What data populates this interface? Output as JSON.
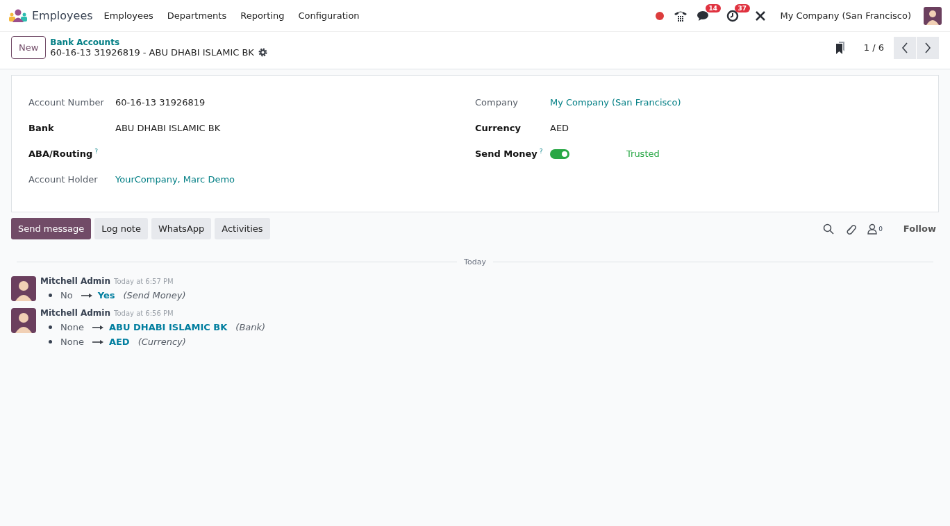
{
  "navbar": {
    "app_name": "Employees",
    "menu": [
      "Employees",
      "Departments",
      "Reporting",
      "Configuration"
    ],
    "messages_count": "14",
    "activities_count": "37",
    "company": "My Company (San Francisco)"
  },
  "control_panel": {
    "new_button": "New",
    "breadcrumb": "Bank Accounts",
    "record_title": "60-16-13 31926819 - ABU DHABI ISLAMIC BK",
    "pager": "1 / 6"
  },
  "form": {
    "left": [
      {
        "label": "Account Number",
        "required": false,
        "kind": "text",
        "value": "60-16-13 31926819"
      },
      {
        "label": "Bank",
        "required": true,
        "kind": "text",
        "value": "ABU DHABI ISLAMIC BK"
      },
      {
        "label": "ABA/Routing",
        "required": true,
        "help": "?",
        "kind": "empty"
      },
      {
        "label": "Account Holder",
        "required": false,
        "kind": "link",
        "value": "YourCompany, Marc Demo"
      }
    ],
    "right": [
      {
        "label": "Company",
        "required": false,
        "kind": "link",
        "value": "My Company (San Francisco)"
      },
      {
        "label": "Currency",
        "required": true,
        "kind": "text",
        "value": "AED"
      },
      {
        "label": "Send Money",
        "required": true,
        "help": "?",
        "kind": "toggle",
        "on": true,
        "value": "Trusted"
      }
    ]
  },
  "chatter": {
    "buttons": [
      {
        "label": "Send message",
        "selected": true
      },
      {
        "label": "Log note",
        "selected": false
      },
      {
        "label": "WhatsApp",
        "selected": false
      },
      {
        "label": "Activities",
        "selected": false
      }
    ],
    "followers_count": "0",
    "follow": "Follow",
    "separator": "Today",
    "messages": [
      {
        "author": "Mitchell Admin",
        "date": "Today at 6:57 PM",
        "changes": [
          {
            "old": "No",
            "new": "Yes",
            "field": "(Send Money)"
          }
        ]
      },
      {
        "author": "Mitchell Admin",
        "date": "Today at 6:56 PM",
        "changes": [
          {
            "old": "None",
            "new": "ABU DHABI ISLAMIC BK",
            "field": "(Bank)"
          },
          {
            "old": "None",
            "new": "AED",
            "field": "(Currency)"
          }
        ]
      }
    ]
  }
}
